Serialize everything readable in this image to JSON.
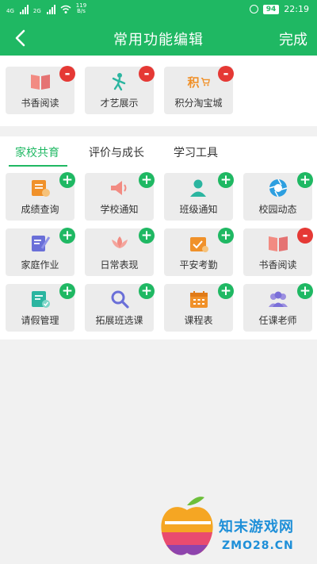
{
  "status": {
    "sig1": "4G",
    "sig2": "2G",
    "speed_value": "119",
    "speed_unit": "B/s",
    "battery": "94",
    "time": "22:19"
  },
  "header": {
    "title": "常用功能编辑",
    "done": "完成"
  },
  "favorites": [
    {
      "label": "书香阅读",
      "icon": "book-icon",
      "action": "-"
    },
    {
      "label": "才艺展示",
      "icon": "dancer-icon",
      "action": "-"
    },
    {
      "label": "积分淘宝城",
      "icon": "points-cart-icon",
      "action": "-",
      "icon_text": "积"
    }
  ],
  "tabs": [
    {
      "label": "家校共育",
      "active": true
    },
    {
      "label": "评价与成长",
      "active": false
    },
    {
      "label": "学习工具",
      "active": false
    }
  ],
  "grid": [
    {
      "label": "成绩查询",
      "icon": "report-icon",
      "action": "+"
    },
    {
      "label": "学校通知",
      "icon": "speaker-icon",
      "action": "+"
    },
    {
      "label": "班级通知",
      "icon": "person-icon",
      "action": "+"
    },
    {
      "label": "校园动态",
      "icon": "camera-shutter-icon",
      "action": "+"
    },
    {
      "label": "家庭作业",
      "icon": "homework-icon",
      "action": "+"
    },
    {
      "label": "日常表现",
      "icon": "lotus-icon",
      "action": "+"
    },
    {
      "label": "平安考勤",
      "icon": "attendance-icon",
      "action": "+"
    },
    {
      "label": "书香阅读",
      "icon": "book-icon",
      "action": "-"
    },
    {
      "label": "请假管理",
      "icon": "leave-icon",
      "action": "+"
    },
    {
      "label": "拓展班选课",
      "icon": "search-icon",
      "action": "+"
    },
    {
      "label": "课程表",
      "icon": "calendar-icon",
      "action": "+"
    },
    {
      "label": "任课老师",
      "icon": "teachers-icon",
      "action": "+"
    }
  ],
  "watermark": {
    "line1": "知末游戏网",
    "line2": "ZMO28.CN"
  },
  "colors": {
    "accent": "#1fb863",
    "remove": "#e53935",
    "tile_bg": "#ececec",
    "watermark": "#1e8fd8"
  }
}
